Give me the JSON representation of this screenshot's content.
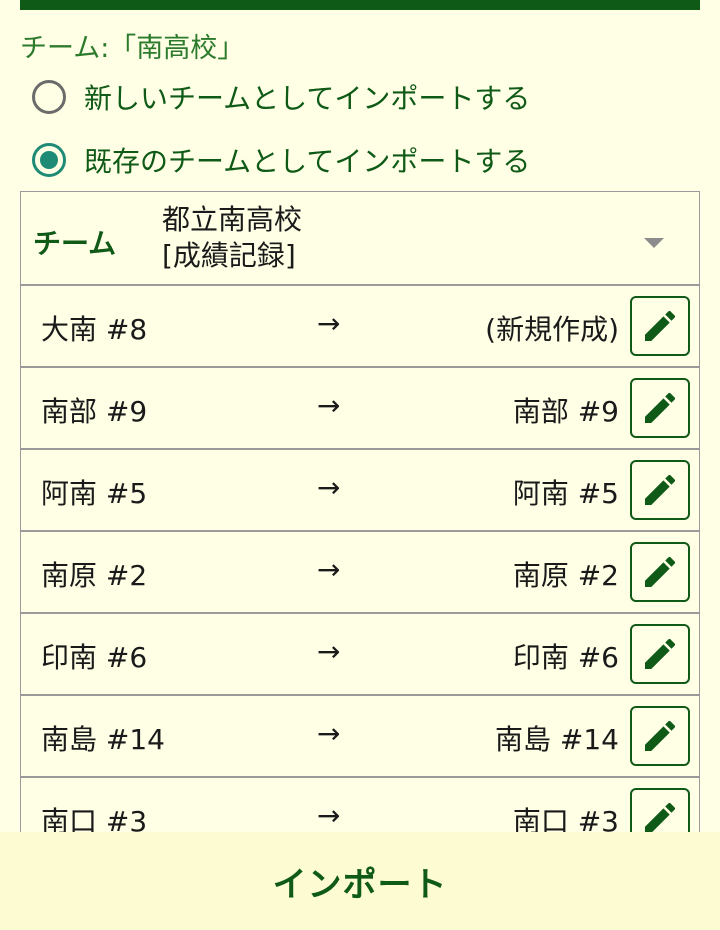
{
  "section_title": "チーム:「南高校」",
  "options": {
    "new_team": "新しいチームとしてインポートする",
    "existing_team": "既存のチームとしてインポートする"
  },
  "team_select": {
    "label": "チーム",
    "value": "都立南高校\n[成績記録]"
  },
  "arrow": "→",
  "mappings": [
    {
      "source": "大南  #8",
      "target": "(新規作成)"
    },
    {
      "source": "南部  #9",
      "target": "南部  #9"
    },
    {
      "source": "阿南  #5",
      "target": "阿南  #5"
    },
    {
      "source": "南原  #2",
      "target": "南原  #2"
    },
    {
      "source": "印南  #6",
      "target": "印南  #6"
    },
    {
      "source": "南島  #14",
      "target": "南島  #14"
    },
    {
      "source": "南口  #3",
      "target": "南口  #3"
    }
  ],
  "import_button": "インポート",
  "colors": {
    "background": "#ffffe6",
    "primary_green": "#0f5a16",
    "radio_teal": "#1f8a75"
  },
  "icons": {
    "edit": "pencil-icon",
    "dropdown": "caret-down-icon"
  }
}
